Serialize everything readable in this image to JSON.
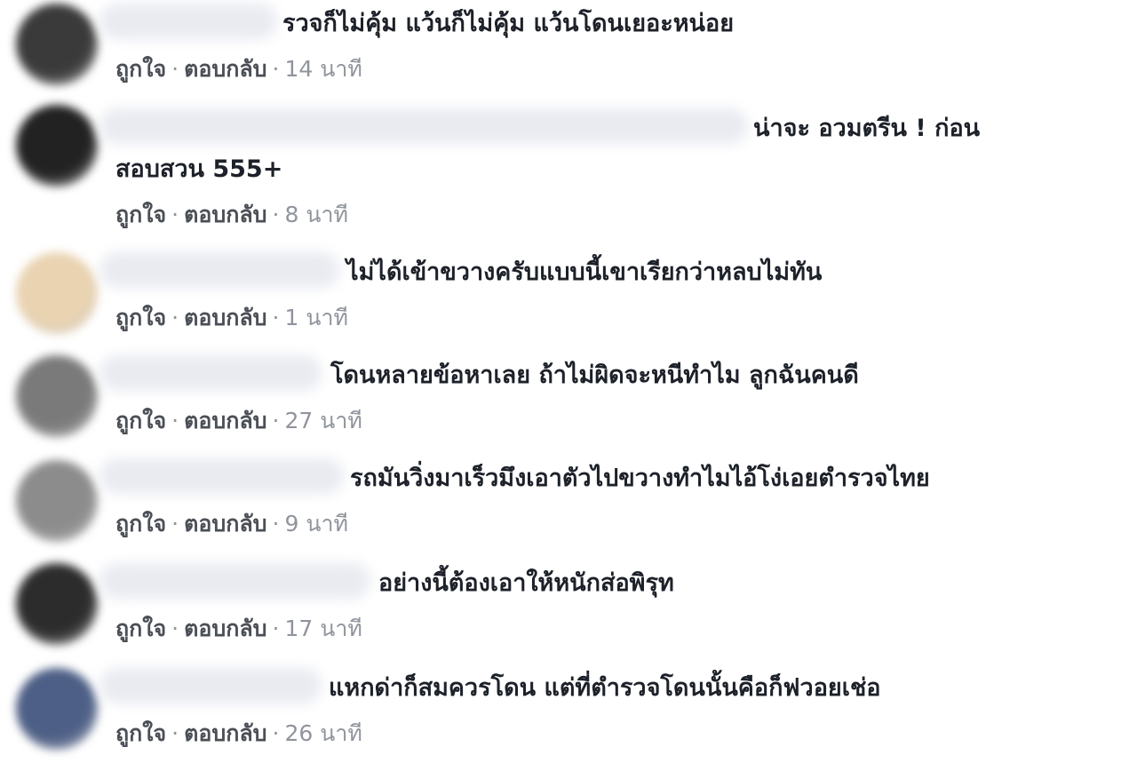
{
  "actions": {
    "like": "ถูกใจ",
    "reply": "ตอบกลับ",
    "separator": "·"
  },
  "comments": [
    {
      "text": "รวจก็ไม่คุ้ม แว้นก็ไม่คุ้ม แว้นโดนเยอะหน่อย",
      "time": "14 นาที",
      "avatar_color": "#3a3a3a"
    },
    {
      "text": "น่าจะ อวมตรีน ! ก่อน สอบสวน 555+",
      "time": "8 นาที",
      "avatar_color": "#222222"
    },
    {
      "text": "ไม่ได้เข้าขวางครับแบบนี้เขาเรียกว่าหลบไม่ทัน",
      "time": "1 นาที",
      "avatar_color": "#e9d3b1"
    },
    {
      "text": "โดนหลายข้อหาเลย ถ้าไม่ผิดจะหนีทำไม ลูกฉันคนดี",
      "time": "27 นาที",
      "avatar_color": "#7a7a7a"
    },
    {
      "text": "รถมันวิ่งมาเร็วมึงเอาตัวไปขวางทำไมไอ้โง่เอยตำรวจไทย",
      "time": "9 นาที",
      "avatar_color": "#8c8c8c"
    },
    {
      "text": "อย่างนี้ต้องเอาให้หนักส่อพิรุท",
      "time": "17 นาที",
      "avatar_color": "#2c2c2c"
    },
    {
      "text": "แหกด่าก็สมควรโดน แต่ที่ตำรวจโดนนั้นคือก็ฟวอยเช่อ",
      "time": "26 นาที",
      "avatar_color": "#4d5f86"
    }
  ]
}
